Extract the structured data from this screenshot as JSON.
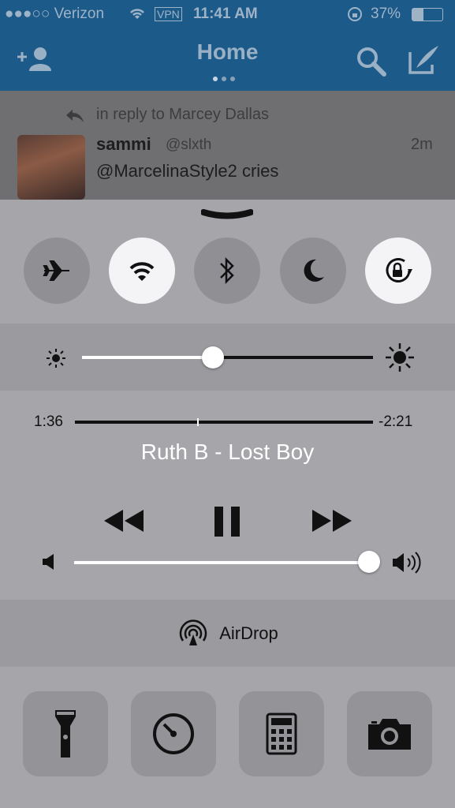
{
  "status_bar": {
    "carrier": "●●●○○ Verizon",
    "vpn": "VPN",
    "time": "11:41 AM",
    "battery": "37%"
  },
  "header": {
    "title": "Home",
    "page_dots": 3,
    "active_dot": 0
  },
  "tweet": {
    "reply_to": "in reply to Marcey Dallas",
    "author": "sammi",
    "handle": "@slxth",
    "age": "2m",
    "text": "@MarcelinaStyle2 cries"
  },
  "control_center": {
    "toggles": [
      {
        "name": "airplane-mode",
        "icon": "airplane-icon",
        "on": false
      },
      {
        "name": "wifi",
        "icon": "wifi-icon",
        "on": true
      },
      {
        "name": "bluetooth",
        "icon": "bluetooth-icon",
        "on": false
      },
      {
        "name": "do-not-disturb",
        "icon": "moon-icon",
        "on": false
      },
      {
        "name": "rotation-lock",
        "icon": "rotation-lock-icon",
        "on": true
      }
    ],
    "brightness": 0.45,
    "media": {
      "elapsed": "1:36",
      "remaining": "-2:21",
      "progress": 0.41,
      "title": "Ruth B - Lost Boy"
    },
    "volume": 1.0,
    "airdrop_label": "AirDrop",
    "shortcuts": [
      "flashlight-icon",
      "timer-icon",
      "calculator-icon",
      "camera-icon"
    ]
  },
  "colors": {
    "header_bg": "#1c5a8a",
    "panel_bg": "#a6a6aa",
    "toggle_on": "#f4f4f6",
    "toggle_off": "#8f8f94"
  }
}
